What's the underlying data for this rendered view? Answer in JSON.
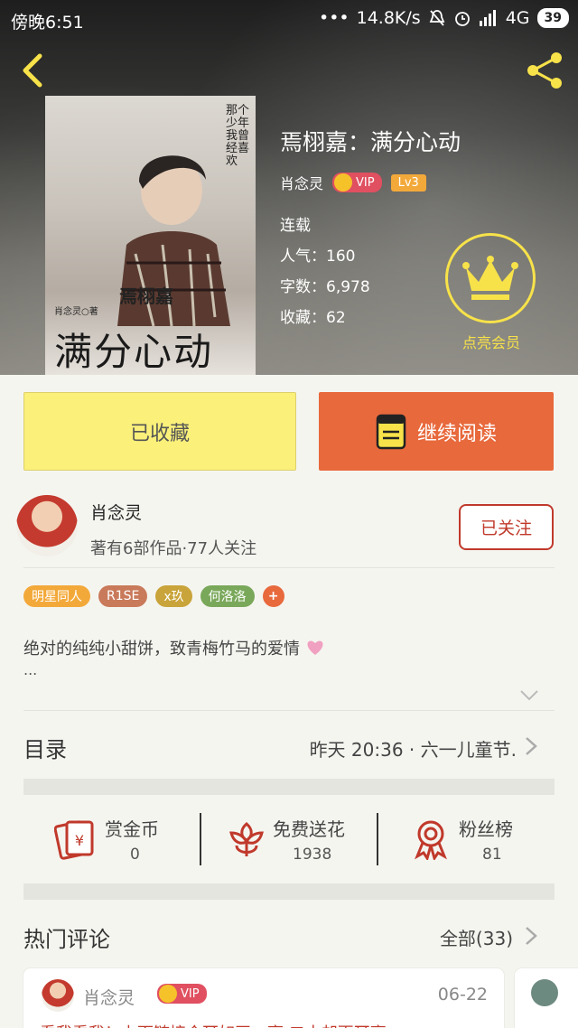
{
  "status_bar": {
    "time": "傍晚6:51",
    "dots": "•••",
    "speed": "14.8K/s",
    "network": "4G",
    "battery": "39"
  },
  "book": {
    "title": "焉栩嘉：满分心动",
    "author": "肖念灵",
    "vip_label": "VIP",
    "level": "Lv3",
    "status": "连载",
    "popularity": "人气：160",
    "word_count": "字数：6,978",
    "collections": "收藏：62"
  },
  "cover": {
    "name_text": "焉栩嘉",
    "big_title": "满分心动",
    "author_line": "肖念灵○著",
    "calligraphy": "那个少年我曾经喜欢"
  },
  "member": {
    "label": "点亮会员"
  },
  "actions": {
    "collected": "已收藏",
    "continue_reading": "继续阅读"
  },
  "author_card": {
    "name": "肖念灵",
    "stats": "著有6部作品·77人关注",
    "follow_label": "已关注"
  },
  "tags": [
    {
      "label": "明星同人",
      "color": "#f3a93a"
    },
    {
      "label": "R1SE",
      "color": "#c97a5a"
    },
    {
      "label": "x玖",
      "color": "#c9a43a"
    },
    {
      "label": "何洛洛",
      "color": "#7aa85a"
    },
    {
      "label": "+",
      "color": "#e8693c"
    }
  ],
  "description": {
    "text": "绝对的纯纯小甜饼，致青梅竹马的爱情",
    "more": "..."
  },
  "toc": {
    "label": "目录",
    "latest": "昨天 20:36 · 六一儿童节."
  },
  "stats": [
    {
      "label": "赏金币",
      "value": "0"
    },
    {
      "label": "免费送花",
      "value": "1938"
    },
    {
      "label": "粉丝榜",
      "value": "81"
    }
  ],
  "comments": {
    "heading": "热门评论",
    "all_label": "全部(33)",
    "items": [
      {
        "user": "肖念灵",
        "vip": "VIP",
        "date": "06-22",
        "text": "看我看我！上面链接合耳如画一亭 二十却更耳亭"
      }
    ]
  },
  "colors": {
    "accent": "#e8693c",
    "yellow": "#faf07a",
    "red": "#c0392b",
    "gold": "#f7e24a"
  }
}
